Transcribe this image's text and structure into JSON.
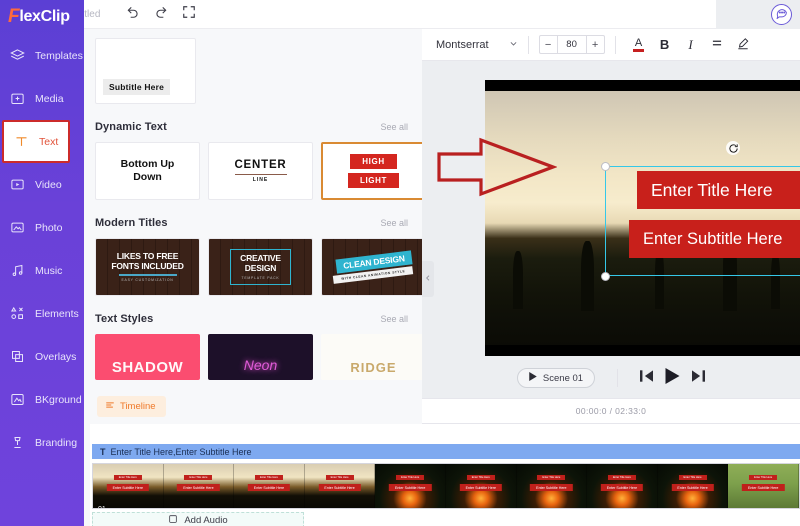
{
  "brand": {
    "prefix": "F",
    "rest": "lexClip"
  },
  "sidebar": {
    "items": [
      {
        "label": "Templates",
        "icon": "templates-icon"
      },
      {
        "label": "Media",
        "icon": "media-icon"
      },
      {
        "label": "Text",
        "icon": "text-icon"
      },
      {
        "label": "Video",
        "icon": "video-icon"
      },
      {
        "label": "Photo",
        "icon": "photo-icon"
      },
      {
        "label": "Music",
        "icon": "music-icon"
      },
      {
        "label": "Elements",
        "icon": "elements-icon"
      },
      {
        "label": "Overlays",
        "icon": "overlays-icon"
      },
      {
        "label": "BKground",
        "icon": "background-icon"
      },
      {
        "label": "Branding",
        "icon": "branding-icon"
      }
    ],
    "active": "Text"
  },
  "topbar": {
    "ratio": "16:9",
    "title": "Untitled",
    "undo_icon": "undo-icon",
    "redo_icon": "redo-icon",
    "fullscreen_icon": "fullscreen-icon",
    "chat_icon": "chat-bubble-icon"
  },
  "panel": {
    "subtitle_preview": "Subtitle Here",
    "sections": [
      {
        "title": "Dynamic Text",
        "see_all": "See all"
      },
      {
        "title": "Modern Titles",
        "see_all": "See all"
      },
      {
        "title": "Text Styles",
        "see_all": "See all"
      }
    ],
    "dynamic_text": [
      {
        "line1": "Bottom Up",
        "line2": "Down"
      },
      {
        "line1": "CENTER",
        "line2": "LINE"
      },
      {
        "line1": "HIGH",
        "line2": "LIGHT",
        "selected": true
      }
    ],
    "modern_titles": [
      {
        "line1": "LIKES TO FREE",
        "line2": "FONTS INCLUDED",
        "sub": "EASY CUSTOMIZATION"
      },
      {
        "line1": "CREATIVE",
        "line2": "DESIGN",
        "sub": "TEMPLATE PACK"
      },
      {
        "line1": "CLEAN DESIGN",
        "sub": "WITH CLEAN ANIMATION STYLE"
      }
    ],
    "text_styles": [
      {
        "label": "SHADOW"
      },
      {
        "label": "Neon"
      },
      {
        "label": "RIDGE"
      }
    ],
    "timeline_toggle": "Timeline"
  },
  "format_toolbar": {
    "font_family": "Montserrat",
    "chevron_icon": "chevron-down-icon",
    "decrease": "−",
    "font_size": "80",
    "increase": "+",
    "color_label": "A",
    "color_swatch": "#c62020",
    "bold": "B",
    "italic": "I",
    "align_icon": "align-icon",
    "highlight_icon": "pen-icon"
  },
  "canvas": {
    "title_text": "Enter Title Here",
    "subtitle_text": "Enter Subtitle Here",
    "band_color": "#c8201b",
    "selection_color": "#35c8e8",
    "rotate_icon": "rotate-icon",
    "collapse_icon": "chevron-left-icon",
    "annotation_icon": "red-arrow-annotation"
  },
  "player": {
    "scene_label": "Scene 01",
    "play_small_icon": "play-icon",
    "prev_icon": "skip-previous-icon",
    "play_icon": "play-icon",
    "next_icon": "skip-next-icon",
    "timecode": "00:00:0 / 02:33:0"
  },
  "timeline": {
    "text_track_icon": "T",
    "text_track_label": "Enter Title Here,Enter Subtitle Here",
    "clip_number": "01",
    "add_audio_label": "Add Audio",
    "add_audio_icon": "add-audio-icon",
    "thumbnails": [
      {
        "kind": "sunset",
        "title": "Enter Title Here",
        "subtitle": "Enter Subtitle Here"
      },
      {
        "kind": "sunset",
        "title": "Enter Title Here",
        "subtitle": "Enter Subtitle Here"
      },
      {
        "kind": "sunset",
        "title": "Enter Title Here",
        "subtitle": "Enter Subtitle Here"
      },
      {
        "kind": "sunset",
        "title": "Enter Title Here",
        "subtitle": "Enter Subtitle Here"
      },
      {
        "kind": "fire",
        "title": "Enter Title Here",
        "subtitle": "Enter Subtitle Here"
      },
      {
        "kind": "fire",
        "title": "Enter Title Here",
        "subtitle": "Enter Subtitle Here"
      },
      {
        "kind": "fire",
        "title": "Enter Title Here",
        "subtitle": "Enter Subtitle Here"
      },
      {
        "kind": "fire",
        "title": "Enter Title Here",
        "subtitle": "Enter Subtitle Here"
      },
      {
        "kind": "fire",
        "title": "Enter Title Here",
        "subtitle": "Enter Subtitle Here"
      },
      {
        "kind": "field",
        "title": "Enter Title Here",
        "subtitle": "Enter Subtitle Here"
      }
    ]
  }
}
